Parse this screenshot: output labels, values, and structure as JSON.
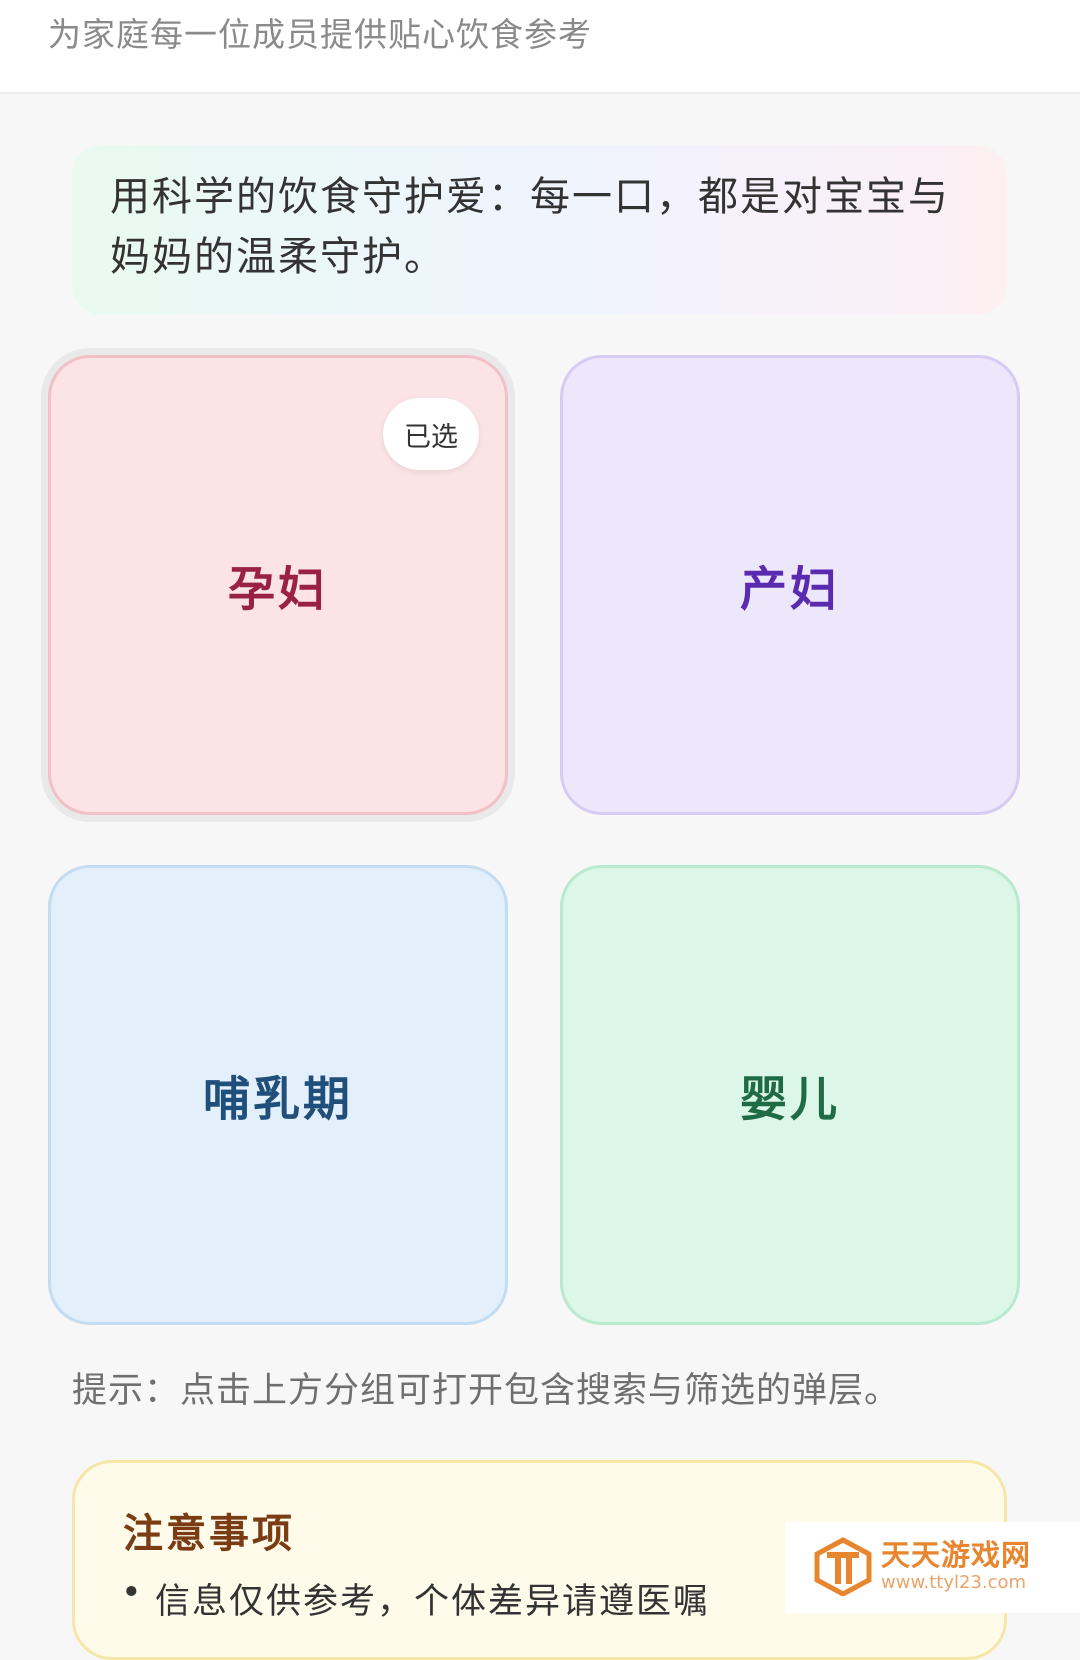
{
  "header": {
    "subtitle": "为家庭每一位成员提供贴心饮食参考"
  },
  "banner": {
    "text": "用科学的饮食守护爱：每一口，都是对宝宝与妈妈的温柔守护。"
  },
  "groups": [
    {
      "label": "孕妇",
      "selected": true,
      "badge": "已选",
      "color": "#9a2146"
    },
    {
      "label": "产妇",
      "selected": false,
      "color": "#5a2bb0"
    },
    {
      "label": "哺乳期",
      "selected": false,
      "color": "#1f4f7a"
    },
    {
      "label": "婴儿",
      "selected": false,
      "color": "#1f6b46"
    }
  ],
  "hint": "提示：点击上方分组可打开包含搜索与筛选的弹层。",
  "notice": {
    "title": "注意事项",
    "items": [
      "信息仅供参考，个体差异请遵医嘱"
    ]
  },
  "watermark": {
    "name": "天天游戏网",
    "url": "www.ttyl23.com"
  }
}
